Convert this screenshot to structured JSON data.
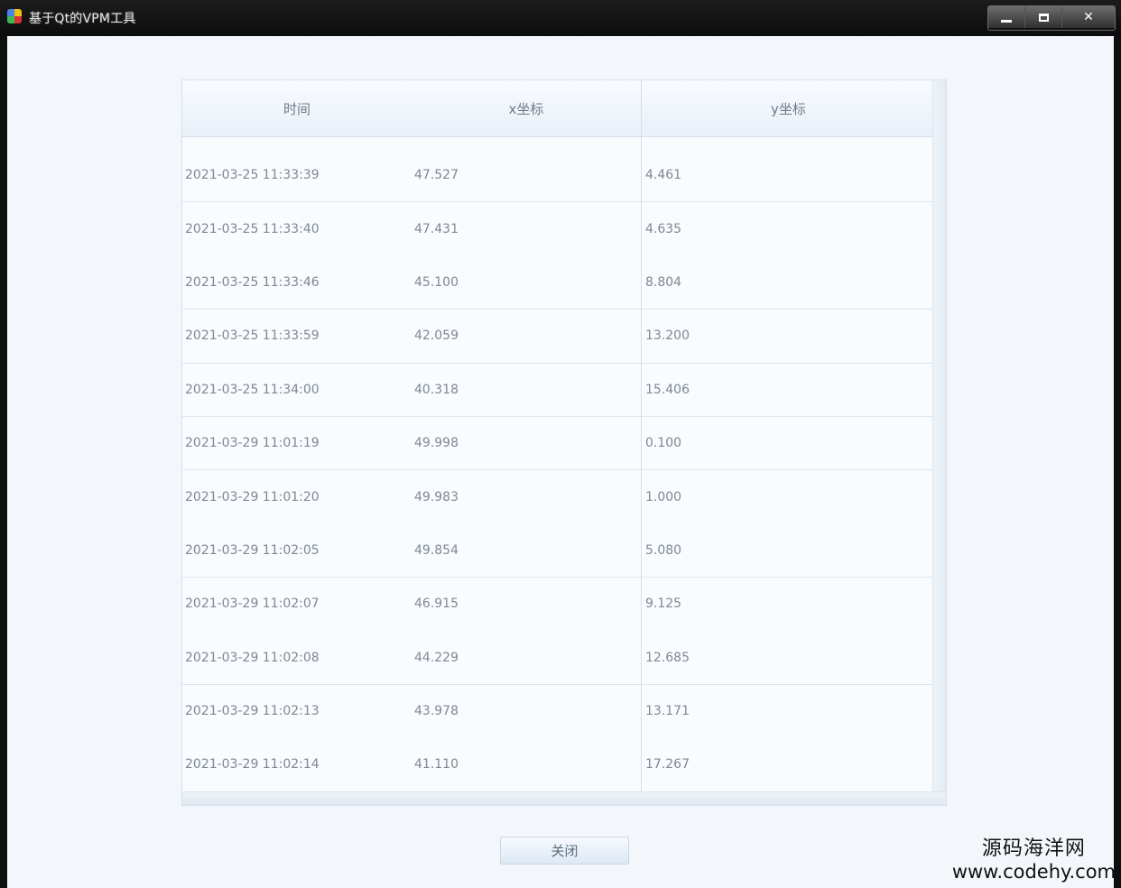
{
  "window": {
    "title": "基于Qt的VPM工具",
    "buttons": {
      "minimize": "",
      "maximize": "",
      "close": "✕"
    }
  },
  "table": {
    "headers": {
      "time": "时间",
      "x": "x坐标",
      "y": "y坐标"
    },
    "rows": [
      {
        "time": "2021-03-25 11:33:39",
        "x": "47.527",
        "y": "4.461"
      },
      {
        "time": "2021-03-25 11:33:40",
        "x": "47.431",
        "y": "4.635"
      },
      {
        "time": "2021-03-25 11:33:46",
        "x": "45.100",
        "y": "8.804"
      },
      {
        "time": "2021-03-25 11:33:59",
        "x": "42.059",
        "y": "13.200"
      },
      {
        "time": "2021-03-25 11:34:00",
        "x": "40.318",
        "y": "15.406"
      },
      {
        "time": "2021-03-29 11:01:19",
        "x": "49.998",
        "y": "0.100"
      },
      {
        "time": "2021-03-29 11:01:20",
        "x": "49.983",
        "y": "1.000"
      },
      {
        "time": "2021-03-29 11:02:05",
        "x": "49.854",
        "y": "5.080"
      },
      {
        "time": "2021-03-29 11:02:07",
        "x": "46.915",
        "y": "9.125"
      },
      {
        "time": "2021-03-29 11:02:08",
        "x": "44.229",
        "y": "12.685"
      },
      {
        "time": "2021-03-29 11:02:13",
        "x": "43.978",
        "y": "13.171"
      },
      {
        "time": "2021-03-29 11:02:14",
        "x": "41.110",
        "y": "17.267"
      }
    ]
  },
  "actions": {
    "close_label": "关闭"
  },
  "watermark": {
    "name": "源码海洋网",
    "url": "www.codehy.com"
  }
}
